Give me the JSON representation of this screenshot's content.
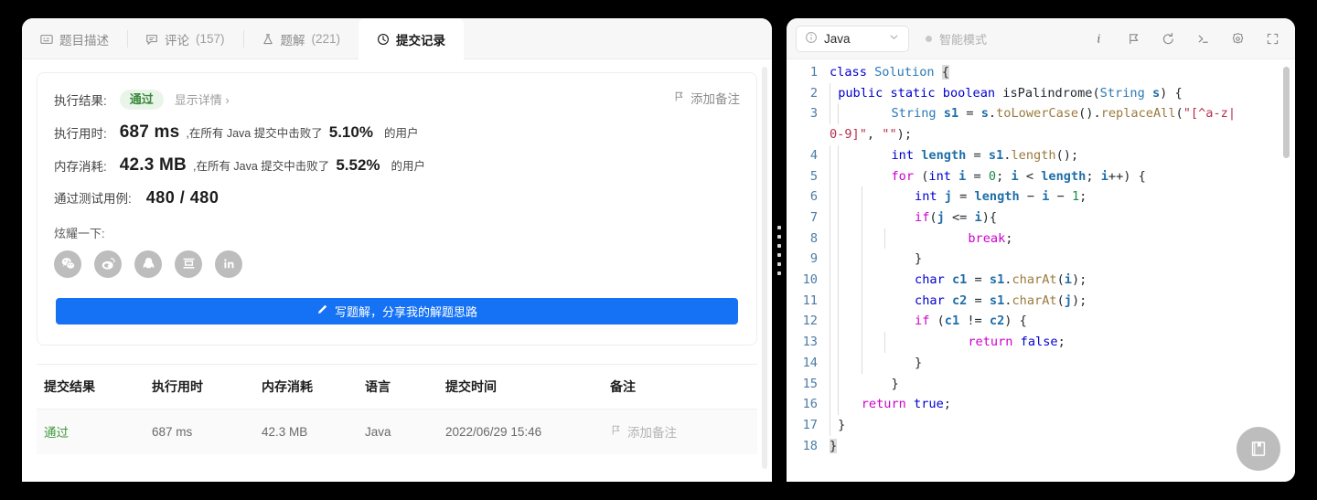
{
  "tabs": [
    {
      "label": "题目描述",
      "icon": "description-icon",
      "count": "",
      "active": false
    },
    {
      "label": "评论",
      "icon": "comment-icon",
      "count": "(157)",
      "active": false
    },
    {
      "label": "题解",
      "icon": "flask-icon",
      "count": "(221)",
      "active": false
    },
    {
      "label": "提交记录",
      "icon": "clock-icon",
      "count": "",
      "active": true
    }
  ],
  "result": {
    "exec_result_label": "执行结果:",
    "status_badge": "通过",
    "detail_link": "显示详情 ›",
    "add_note": "添加备注",
    "runtime_label": "执行用时:",
    "runtime_value": "687 ms",
    "runtime_suffix_a": ",在所有 Java 提交中击败了",
    "runtime_percent": "5.10%",
    "runtime_suffix_b": "的用户",
    "memory_label": "内存消耗:",
    "memory_value": "42.3 MB",
    "memory_suffix_a": ",在所有 Java 提交中击败了",
    "memory_percent": "5.52%",
    "memory_suffix_b": "的用户",
    "cases_label": "通过测试用例:",
    "cases_value": "480 / 480",
    "share_label": "炫耀一下:",
    "share_icons": [
      "wechat-icon",
      "weibo-icon",
      "qq-icon",
      "douban-icon",
      "linkedin-icon"
    ],
    "write_button": "写题解，分享我的解题思路",
    "write_button_icon": "pencil-icon",
    "accent_blue": "#1672f5",
    "badge_green": "#3b8a3b"
  },
  "table": {
    "headers": [
      "提交结果",
      "执行用时",
      "内存消耗",
      "语言",
      "提交时间",
      "备注"
    ],
    "rows": [
      {
        "status": "通过",
        "runtime": "687 ms",
        "memory": "42.3 MB",
        "language": "Java",
        "time": "2022/06/29 15:46",
        "note": "添加备注"
      }
    ]
  },
  "editor": {
    "language": "Java",
    "language_icon": "info-circle-icon",
    "chevron": "chevron-down-icon",
    "smart_mode": "智能模式",
    "toolbar_icons": [
      "info-icon",
      "run-flag-icon",
      "reset-icon",
      "console-icon",
      "settings-gear-icon",
      "fullscreen-icon"
    ],
    "fab_icon": "notebook-icon",
    "lines": [
      {
        "n": "1",
        "guides": 0,
        "html": "<span class='kw'>class</span> <span class='typ'>Solution</span> <span class='brsel'>{</span>"
      },
      {
        "n": "2",
        "guides": 1,
        "html": "<span class='kw'>public</span> <span class='kw'>static</span> <span class='kw'>boolean</span> isPalindrome(<span class='typ'>String</span> <span class='var'>s</span>) {"
      },
      {
        "n": "3",
        "guides": 2,
        "html": "    <span class='typ'>String</span> <span class='var'>s1</span> = <span class='var'>s</span>.<span class='fn'>toLowerCase</span>().<span class='fn'>replaceAll</span>(<span class='str'>\"[^a-z|</span>"
      },
      {
        "n": "",
        "guides": 0,
        "html": "<span class='str'>0-9]\"</span>, <span class='str'>\"\"</span>);"
      },
      {
        "n": "4",
        "guides": 2,
        "html": "    <span class='kw'>int</span> <span class='var'>length</span> = <span class='var'>s1</span>.<span class='fn'>length</span>();"
      },
      {
        "n": "5",
        "guides": 2,
        "html": "    <span class='kw2'>for</span> (<span class='kw'>int</span> <span class='var'>i</span> = <span class='num'>0</span>; <span class='var'>i</span> &lt; <span class='var'>length</span>; <span class='var'>i</span>++) {"
      },
      {
        "n": "6",
        "guides": 3,
        "html": "    <span class='kw'>int</span> <span class='var'>j</span> = <span class='var'>length</span> − <span class='var'>i</span> − <span class='num'>1</span>;"
      },
      {
        "n": "7",
        "guides": 3,
        "html": "    <span class='kw2'>if</span>(<span class='var'>j</span> &lt;= <span class='var'>i</span>){"
      },
      {
        "n": "8",
        "guides": 4,
        "html": "        <span class='kw2'>break</span>;"
      },
      {
        "n": "9",
        "guides": 3,
        "html": "    }"
      },
      {
        "n": "10",
        "guides": 3,
        "html": "    <span class='kw'>char</span> <span class='var'>c1</span> = <span class='var'>s1</span>.<span class='fn'>charAt</span>(<span class='var'>i</span>);"
      },
      {
        "n": "11",
        "guides": 3,
        "html": "    <span class='kw'>char</span> <span class='var'>c2</span> = <span class='var'>s1</span>.<span class='fn'>charAt</span>(<span class='var'>j</span>);"
      },
      {
        "n": "12",
        "guides": 3,
        "html": "    <span class='kw2'>if</span> (<span class='var'>c1</span> != <span class='var'>c2</span>) {"
      },
      {
        "n": "13",
        "guides": 4,
        "html": "        <span class='kw2'>return</span> <span class='kw'>false</span>;"
      },
      {
        "n": "14",
        "guides": 3,
        "html": "    }"
      },
      {
        "n": "15",
        "guides": 2,
        "html": "    }"
      },
      {
        "n": "16",
        "guides": 2,
        "html": "<span class='kw2'>return</span> <span class='kw'>true</span>;"
      },
      {
        "n": "17",
        "guides": 1,
        "html": "}"
      },
      {
        "n": "18",
        "guides": 0,
        "html": "<span class='brsel'>}</span>"
      }
    ]
  }
}
